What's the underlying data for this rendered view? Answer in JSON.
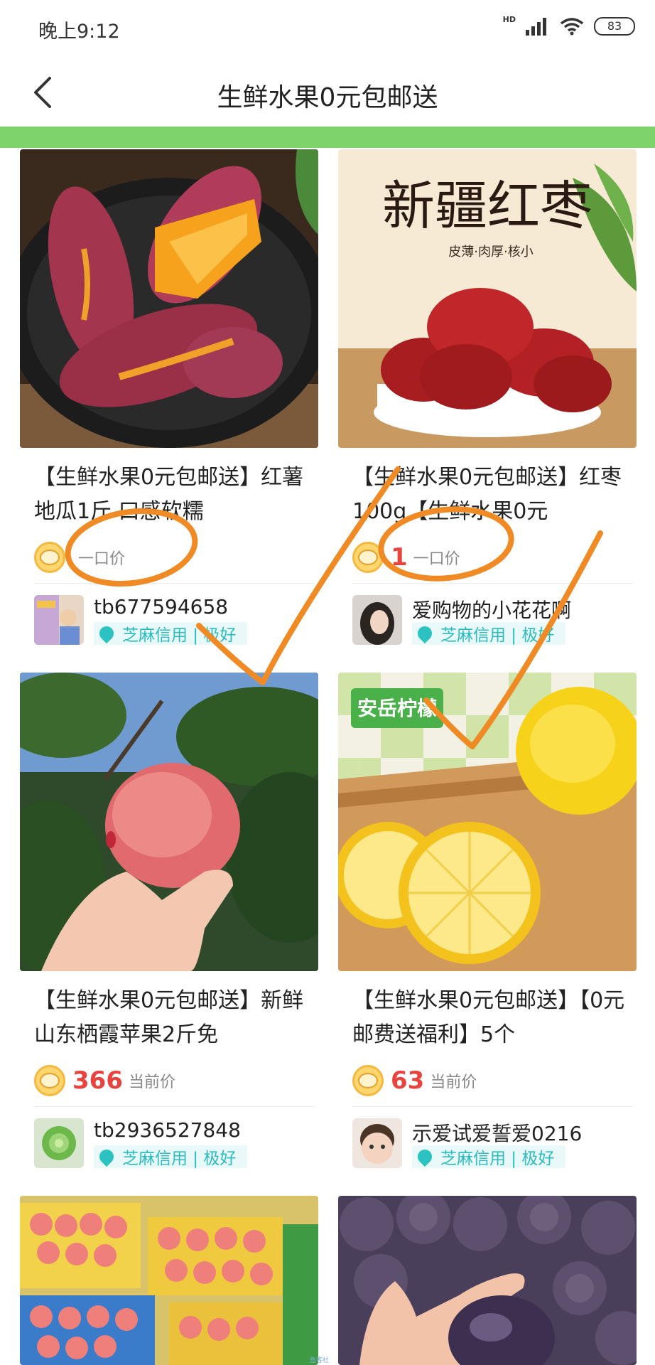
{
  "status_bar": {
    "time": "晚上9:12",
    "network": "HD",
    "battery": "83"
  },
  "nav": {
    "title": "生鲜水果0元包邮送"
  },
  "cards": [
    {
      "title": "【生鲜水果0元包邮送】红薯地瓜1斤 口感软糯",
      "price": "",
      "price_label": "一口价",
      "seller": "tb677594658",
      "credit": "芝麻信用 | 极好"
    },
    {
      "title": "【生鲜水果0元包邮送】红枣100g【生鲜水果0元",
      "price": "1",
      "price_label": "一口价",
      "seller": "爱购物的小花花啊",
      "credit": "芝麻信用 | 极好",
      "image_text": {
        "main": "新疆红枣",
        "sub": "皮薄·肉厚·核小"
      }
    },
    {
      "title": "【生鲜水果0元包邮送】新鲜山东栖霞苹果2斤免",
      "price": "366",
      "price_label": "当前价",
      "seller": "tb2936527848",
      "credit": "芝麻信用 | 极好"
    },
    {
      "title": "【生鲜水果0元包邮送】【0元邮费送福利】5个",
      "price": "63",
      "price_label": "当前价",
      "seller": "示爱试爱誓爱0216",
      "credit": "芝麻信用 | 极好",
      "image_text": {
        "badge": "安岳柠檬"
      }
    }
  ],
  "watermark": "鱼客社",
  "colors": {
    "accent_green": "#7ed36a",
    "price_red": "#e8433f",
    "credit_teal": "#2cbcbf",
    "annotation_orange": "#f08a24"
  }
}
